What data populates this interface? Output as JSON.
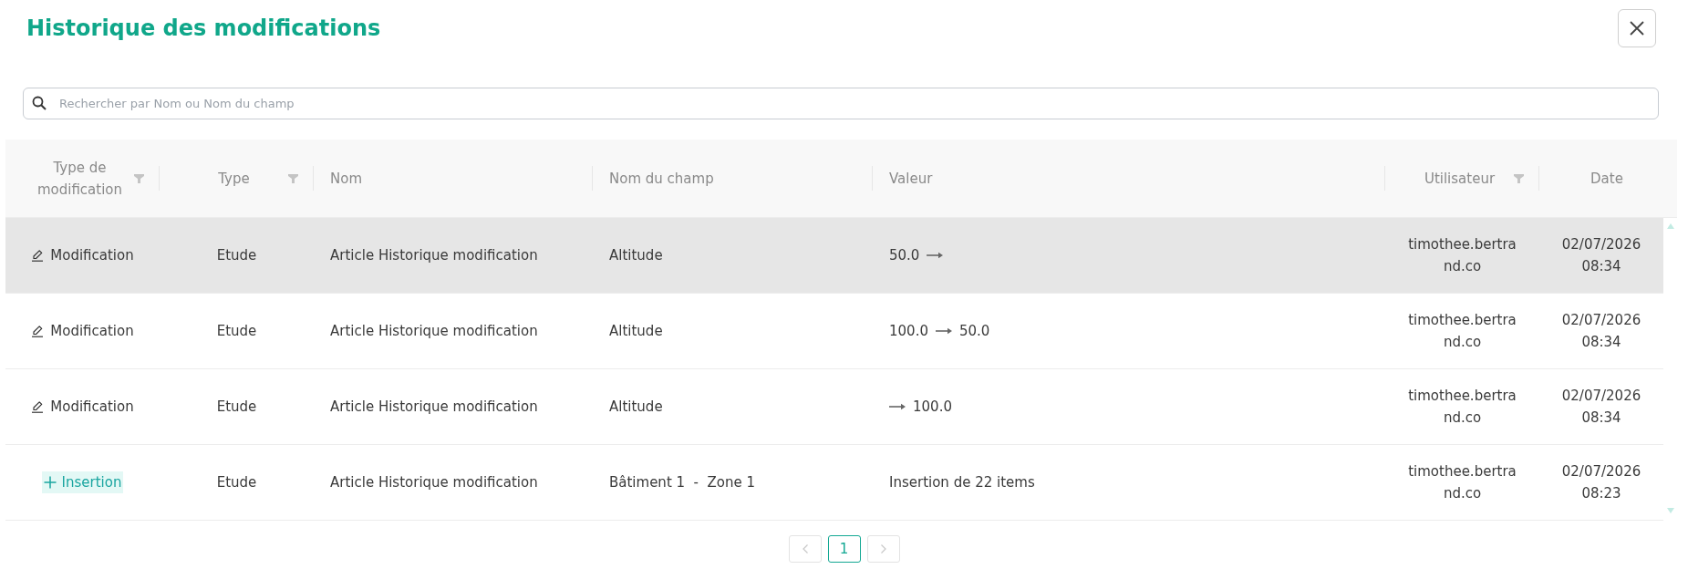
{
  "title": "Historique des modifications",
  "search": {
    "placeholder": "Rechercher par Nom ou Nom du champ"
  },
  "table": {
    "columns": [
      {
        "label": "Type de modification",
        "filterable": true
      },
      {
        "label": "Type",
        "filterable": true
      },
      {
        "label": "Nom",
        "filterable": false
      },
      {
        "label": "Nom du champ",
        "filterable": false
      },
      {
        "label": "Valeur",
        "filterable": false
      },
      {
        "label": "Utilisateur",
        "filterable": true
      },
      {
        "label": "Date",
        "filterable": false
      }
    ],
    "rows": [
      {
        "highlighted": true,
        "kind": "modification",
        "change_type": "Modification",
        "type": "Etude",
        "name": "Article Historique modification",
        "field": "Altitude",
        "value": {
          "from": "50.0"
        },
        "user": "timothee.bertrand.co",
        "date": "02/07/2026 08:34"
      },
      {
        "highlighted": false,
        "kind": "modification",
        "change_type": "Modification",
        "type": "Etude",
        "name": "Article Historique modification",
        "field": "Altitude",
        "value": {
          "from": "100.0",
          "to": "50.0"
        },
        "user": "timothee.bertrand.co",
        "date": "02/07/2026 08:34"
      },
      {
        "highlighted": false,
        "kind": "modification",
        "change_type": "Modification",
        "type": "Etude",
        "name": "Article Historique modification",
        "field": "Altitude",
        "value": {
          "to": "100.0"
        },
        "user": "timothee.bertrand.co",
        "date": "02/07/2026 08:34"
      },
      {
        "highlighted": false,
        "kind": "insertion",
        "change_type": "Insertion",
        "type": "Etude",
        "name": "Article Historique modification",
        "field": "Bâtiment 1  -  Zone 1",
        "value": {
          "text": "Insertion de 22 items"
        },
        "user": "timothee.bertrand.co",
        "date": "02/07/2026 08:23"
      }
    ]
  },
  "pagination": {
    "previous_disabled": true,
    "pages": [
      {
        "label": "1",
        "selected": true
      }
    ],
    "next_disabled": true
  }
}
